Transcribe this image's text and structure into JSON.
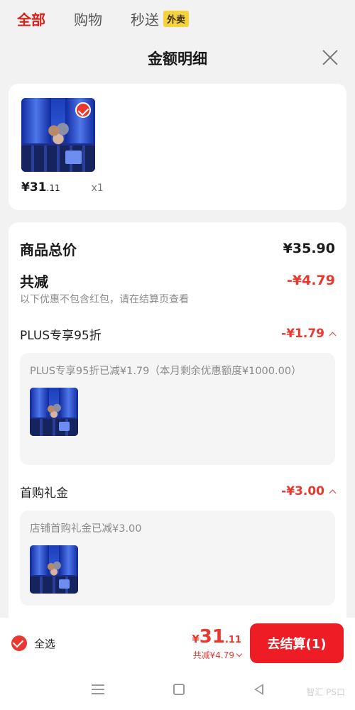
{
  "background_tabs": [
    {
      "label": "全部"
    },
    {
      "label": "购物"
    },
    {
      "label": "秒送",
      "badge": "外卖"
    }
  ],
  "sheet": {
    "title": "金额明细"
  },
  "product": {
    "price_symbol_int": "¥31",
    "price_decimal": ".11",
    "quantity": "x1",
    "selected": true
  },
  "detail": {
    "total_label": "商品总价",
    "total_value": "¥35.90",
    "reduce_label": "共减",
    "reduce_value": "-¥4.79",
    "note": "以下优惠不包含红包，请在结算页查看",
    "discounts": [
      {
        "label": "PLUS专享95折",
        "value": "-¥1.79",
        "description": "PLUS专享95折已减¥1.79（本月剩余优惠额度¥1000.00）"
      },
      {
        "label": "首购礼金",
        "value": "-¥3.00",
        "description": "店铺首购礼金已减¥3.00"
      }
    ]
  },
  "bottom_bar": {
    "select_all_label": "全选",
    "currency": "¥",
    "total_int": "31",
    "total_dec": ".11",
    "total_reduce": "共减¥4.79",
    "checkout_label": "去结算(1)"
  },
  "watermark": "智汇 PS口",
  "colors": {
    "accent_red": "#e8382f",
    "checkout_red": "#ee1c25",
    "sheet_bg": "#f2f2f2"
  },
  "icons": [
    "close-icon",
    "check-icon",
    "chevron-up-icon",
    "chevron-down-icon",
    "nav-menu-icon",
    "nav-home-icon",
    "nav-back-icon"
  ]
}
